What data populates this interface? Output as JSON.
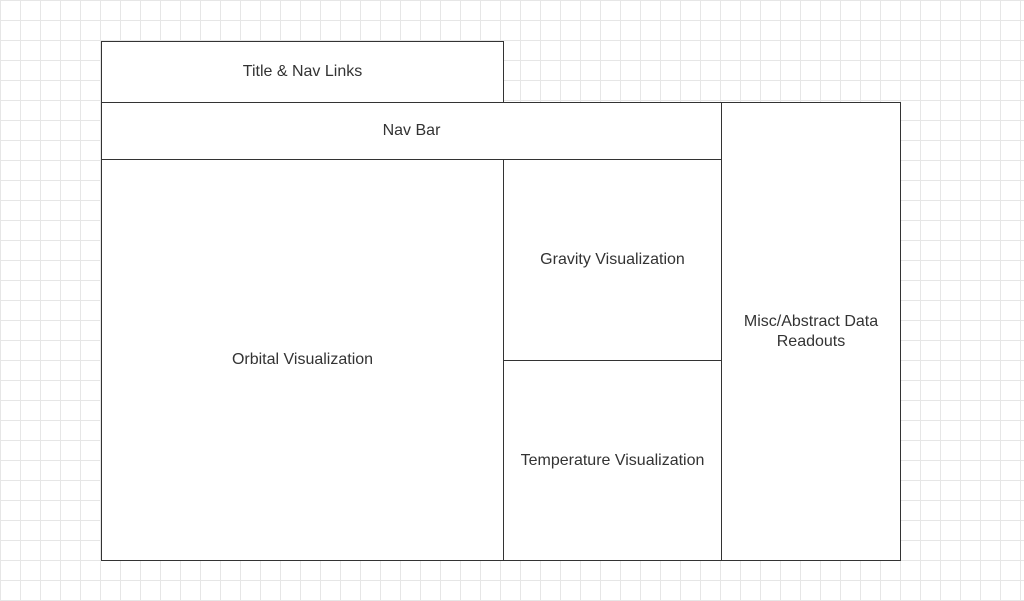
{
  "diagram": {
    "boxes": {
      "title_nav": {
        "label": "Title & Nav Links"
      },
      "nav_bar": {
        "label": "Nav Bar"
      },
      "orbital": {
        "label": "Orbital Visualization"
      },
      "gravity": {
        "label": "Gravity Visualization"
      },
      "temperature": {
        "label": "Temperature Visualization"
      },
      "misc": {
        "label": "Misc/Abstract Data\nReadouts"
      }
    },
    "colors": {
      "grid": "#e6e6e6",
      "box_border": "#333333",
      "box_fill": "#ffffff",
      "text": "#333333"
    }
  }
}
